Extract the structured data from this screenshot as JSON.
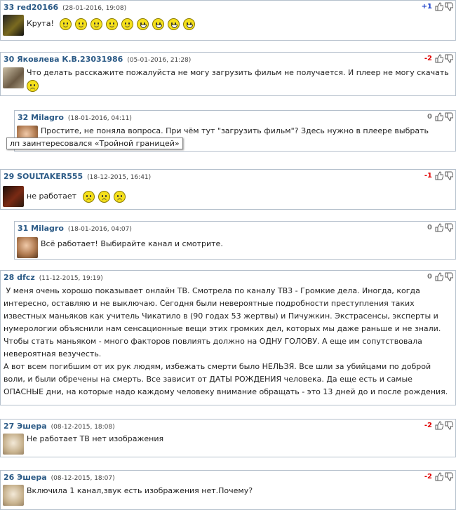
{
  "comments": [
    {
      "num": "33 red20166",
      "date": "(28-01-2016, 19:08)",
      "score": "+1",
      "text": "Крута!"
    },
    {
      "num": "30 Яковлева К.В.23031986",
      "date": "(05-01-2016, 21:28)",
      "score": "-2",
      "text": "Что делать расскажите пожалуйста не могу загрузить фильм не получается. И плеер не могу скачать"
    },
    {
      "num": "32 Milagro",
      "date": "(18-01-2016, 04:11)",
      "score": "0",
      "text": "Простите, не поняла вопроса. При чём тут \"загрузить фильм\"? Здесь нужно в плеере выбрать канал и смотреть."
    },
    {
      "num": "29 SOULTAKER555",
      "date": "(18-12-2015, 16:41)",
      "score": "-1",
      "text": "не работает"
    },
    {
      "num": "31 Milagro",
      "date": "(18-01-2016, 04:07)",
      "score": "0",
      "text": "Всё работает! Выбирайте канал и смотрите."
    },
    {
      "num": "28 dfcz",
      "date": "(11-12-2015, 19:19)",
      "score": "0",
      "text": " У меня очень хорошо показывает онлайн ТВ. Смотрела по каналу ТВ3 - Громкие дела. Иногда, когда интересно, оставляю и не выключаю. Сегодня были невероятные подробности преступления таких известных маньяков как учитель Чикатило в (90 годах 53 жертвы) и Пичужкин. Экстрасенсы, эксперты и нумерологии объяснили нам сенсационные вещи этих громких дел, которых мы даже раньше и не знали. Чтобы стать маньяком - много факторов повлиять должно на ОДНУ ГОЛОВУ. А еще им сопутствовала невероятная везучесть.",
      "text2": "А вот всем погибшим от их рук людям, избежать смерти было НЕЛЬЗЯ. Все шли за убийцами по доброй воли, и были обречены на смерть. Все зависит от ДАТЫ РОЖДЕНИЯ человека. Да еще есть и самые ОПАСНЫЕ дни, на которые надо каждому человеку внимание обращать - это 13 дней до и после рождения."
    },
    {
      "num": "27 Эшера",
      "date": "(08-12-2015, 18:08)",
      "score": "-2",
      "text": "Не работает ТВ нет изображения"
    },
    {
      "num": "26 Эшера",
      "date": "(08-12-2015, 18:07)",
      "score": "-2",
      "text": "Включила 1 канал,звук есть изображения нет.Почему?"
    }
  ],
  "tooltip": "лп заинтересовался «Тройной границей»",
  "colors": {
    "positive": "#1a3fc9",
    "negative": "#e00000",
    "zero": "#777777",
    "border": "#b5c0cc",
    "name": "#2b5a86"
  }
}
